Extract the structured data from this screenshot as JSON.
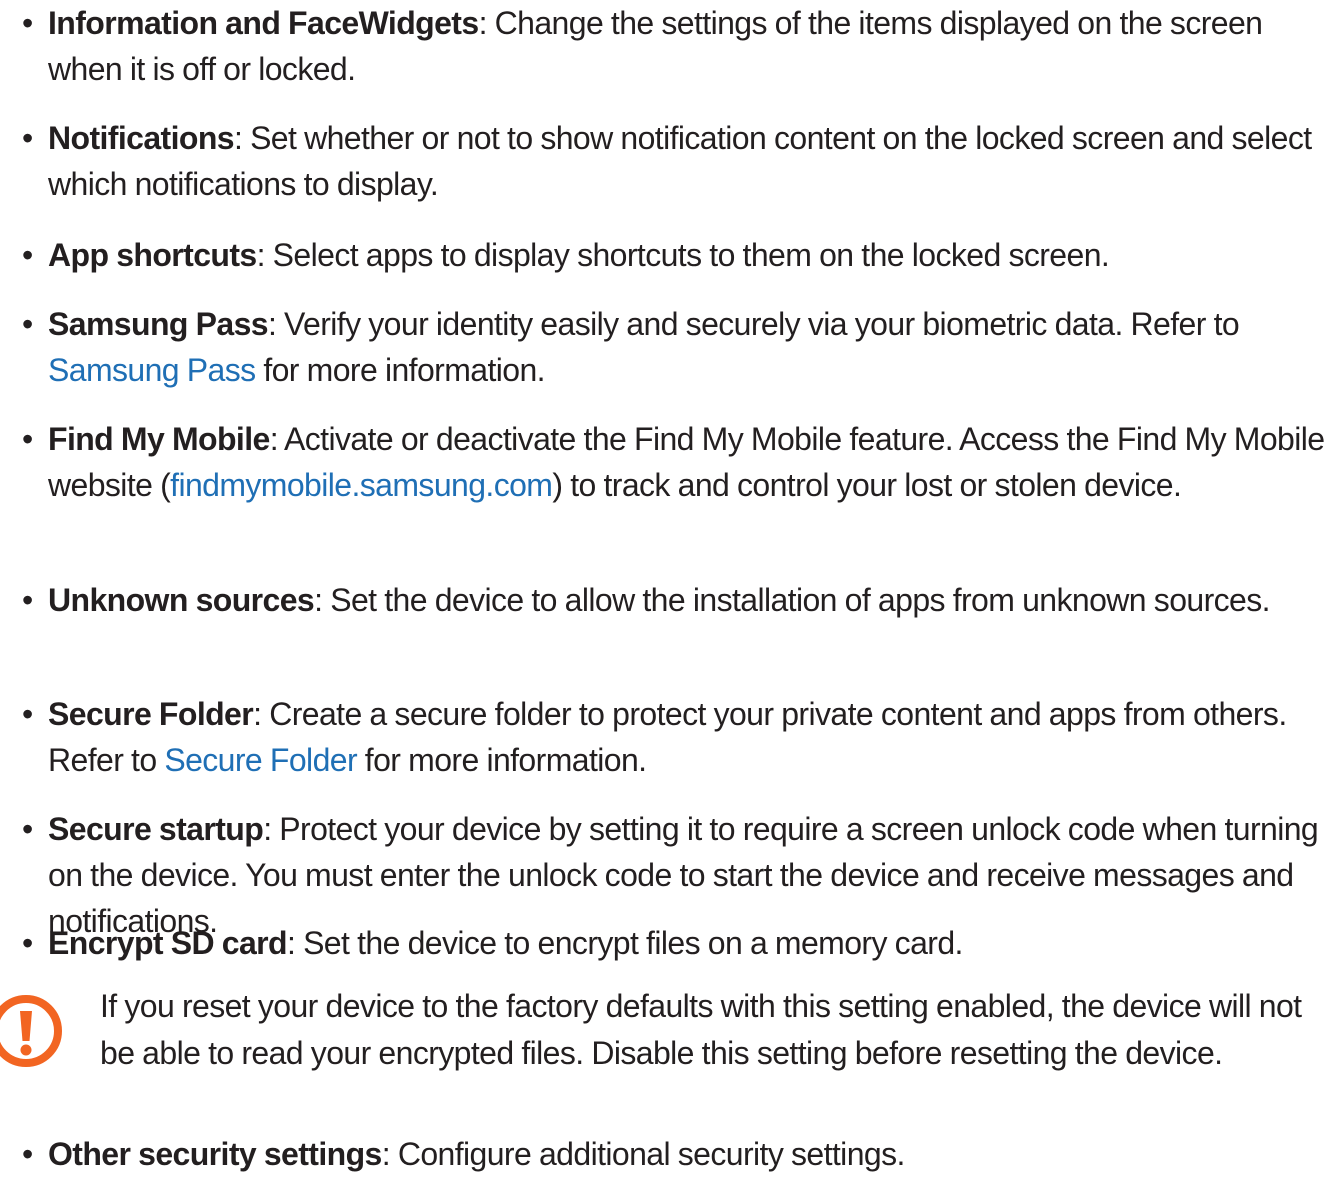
{
  "items": [
    {
      "term": "Information and FaceWidgets",
      "parts": [
        ": Change the settings of the items displayed on the screen when it is off or locked."
      ]
    },
    {
      "term": "Notifications",
      "parts": [
        ": Set whether or not to show notification content on the locked screen and select which notifications to display."
      ]
    },
    {
      "term": "App shortcuts",
      "parts": [
        ": Select apps to display shortcuts to them on the locked screen."
      ]
    },
    {
      "term": "Samsung Pass",
      "parts": [
        ": Verify your identity easily and securely via your biometric data. Refer to ",
        "Samsung Pass",
        " for more information."
      ]
    },
    {
      "term": "Find My Mobile",
      "parts": [
        ": Activate or deactivate the Find My Mobile feature. Access the Find My Mobile website (",
        "findmymobile.samsung.com",
        ") to track and control your lost or stolen device."
      ]
    },
    {
      "term": "Unknown sources",
      "parts": [
        ": Set the device to allow the installation of apps from unknown sources."
      ]
    },
    {
      "term": "Secure Folder",
      "parts": [
        ": Create a secure folder to protect your private content and apps from others. Refer to ",
        "Secure Folder",
        " for more information."
      ]
    },
    {
      "term": "Secure startup",
      "parts": [
        ": Protect your device by setting it to require a screen unlock code when turning on the device. You must enter the unlock code to start the device and receive messages and notifications."
      ]
    },
    {
      "term": "Encrypt SD card",
      "parts": [
        ": Set the device to encrypt files on a memory card."
      ]
    },
    {
      "term": "Other security settings",
      "parts": [
        ": Configure additional security settings."
      ]
    }
  ],
  "bullet_char": "•",
  "caution": {
    "text": "If you reset your device to the factory defaults with this setting enabled, the device will not be able to read your encrypted files. Disable this setting before resetting the device.",
    "icon": "caution-icon"
  },
  "colors": {
    "text": "#231f20",
    "link": "#1f6fb5",
    "caution_icon": "#f26522"
  }
}
